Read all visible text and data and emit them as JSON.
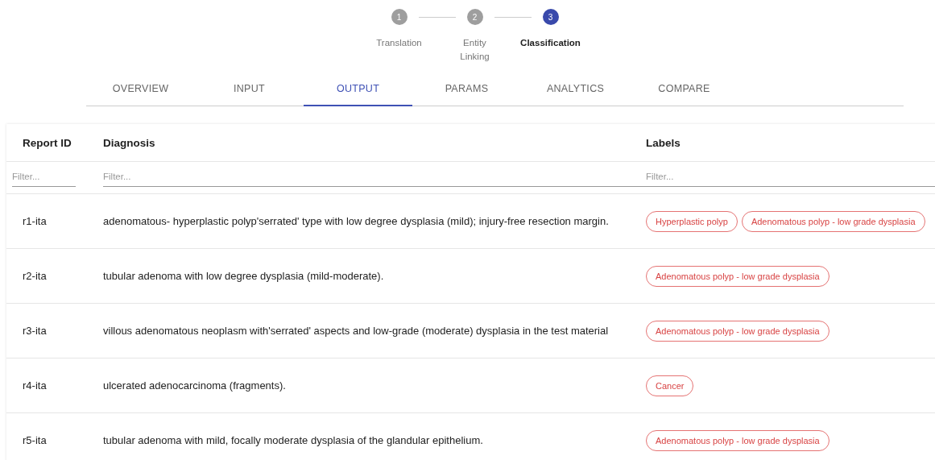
{
  "stepper": {
    "steps": [
      {
        "number": "1",
        "label": "Translation",
        "active": false
      },
      {
        "number": "2",
        "label": "Entity Linking",
        "active": false
      },
      {
        "number": "3",
        "label": "Classification",
        "active": true
      }
    ]
  },
  "tabs": [
    {
      "label": "OVERVIEW",
      "selected": false
    },
    {
      "label": "INPUT",
      "selected": false
    },
    {
      "label": "OUTPUT",
      "selected": true
    },
    {
      "label": "PARAMS",
      "selected": false
    },
    {
      "label": "ANALYTICS",
      "selected": false
    },
    {
      "label": "COMPARE",
      "selected": false
    }
  ],
  "table": {
    "columns": [
      {
        "title": "Report ID",
        "filter_placeholder": "Filter..."
      },
      {
        "title": "Diagnosis",
        "filter_placeholder": "Filter..."
      },
      {
        "title": "Labels",
        "filter_placeholder": "Filter..."
      }
    ],
    "rows": [
      {
        "report_id": "r1-ita",
        "diagnosis": "adenomatous- hyperplastic polyp'serrated' type with low degree dysplasia (mild); injury-free resection margin.",
        "labels": [
          "Hyperplastic polyp",
          "Adenomatous polyp - low grade dysplasia"
        ]
      },
      {
        "report_id": "r2-ita",
        "diagnosis": "tubular adenoma with low degree dysplasia (mild-moderate).",
        "labels": [
          "Adenomatous polyp - low grade dysplasia"
        ]
      },
      {
        "report_id": "r3-ita",
        "diagnosis": "villous adenomatous neoplasm with'serrated' aspects and low-grade (moderate) dysplasia in the test material",
        "labels": [
          "Adenomatous polyp - low grade dysplasia"
        ]
      },
      {
        "report_id": "r4-ita",
        "diagnosis": "ulcerated adenocarcinoma (fragments).",
        "labels": [
          "Cancer"
        ]
      },
      {
        "report_id": "r5-ita",
        "diagnosis": "tubular adenoma with mild, focally moderate dysplasia of the glandular epithelium.",
        "labels": [
          "Adenomatous polyp - low grade dysplasia"
        ]
      }
    ]
  }
}
